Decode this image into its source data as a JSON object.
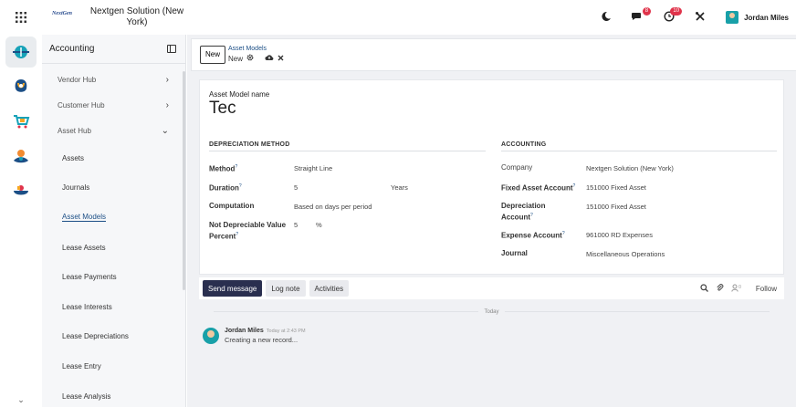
{
  "topbar": {
    "apps_icon": "apps-grid-icon",
    "company_logo": "NextGen",
    "company_name": "Nextgen Solution (New York)",
    "discuss_badge": "8",
    "activities_badge": "10",
    "user_name": "Jordan Miles"
  },
  "sidebar": {
    "title": "Accounting",
    "items": [
      {
        "label": "Vendor Hub",
        "state": "collapsed"
      },
      {
        "label": "Customer Hub",
        "state": "collapsed"
      },
      {
        "label": "Asset Hub",
        "state": "expanded"
      }
    ],
    "sub_items": [
      {
        "label": "Assets"
      },
      {
        "label": "Journals"
      },
      {
        "label": "Asset Models",
        "active": true
      },
      {
        "label": "Lease Assets"
      },
      {
        "label": "Lease Payments"
      },
      {
        "label": "Lease Interests"
      },
      {
        "label": "Lease Depreciations"
      },
      {
        "label": "Lease Entry"
      },
      {
        "label": "Lease Analysis"
      }
    ]
  },
  "control_panel": {
    "new_button": "New",
    "breadcrumb_parent": "Asset Models",
    "breadcrumb_current": "New"
  },
  "form": {
    "name_caption": "Asset Model name",
    "name_value": "Tec",
    "depreciation_section": "DEPRECIATION METHOD",
    "accounting_section": "ACCOUNTING",
    "method_label": "Method",
    "method_value": "Straight Line",
    "duration_label": "Duration",
    "duration_value": "5",
    "duration_unit": "Years",
    "computation_label": "Computation",
    "computation_value": "Based on days per period",
    "not_depreciable_label_1": "Not Depreciable Value",
    "not_depreciable_label_2": "Percent",
    "not_depreciable_value": "5",
    "not_depreciable_unit": "%",
    "company_label": "Company",
    "company_value": "Nextgen Solution (New York)",
    "fixed_asset_label": "Fixed Asset Account",
    "fixed_asset_value": "151000 Fixed Asset",
    "depreciation_account_label_1": "Depreciation",
    "depreciation_account_label_2": "Account",
    "depreciation_account_value": "151000 Fixed Asset",
    "expense_label": "Expense Account",
    "expense_value": "961000 RD Expenses",
    "journal_label": "Journal",
    "journal_value": "Miscellaneous Operations"
  },
  "chatter": {
    "send_message": "Send message",
    "log_note": "Log note",
    "activities": "Activities",
    "followers_count": "0",
    "follow": "Follow",
    "today": "Today",
    "message": {
      "author": "Jordan Miles",
      "time": "Today at 2:43 PM",
      "body": "Creating a new record..."
    }
  }
}
